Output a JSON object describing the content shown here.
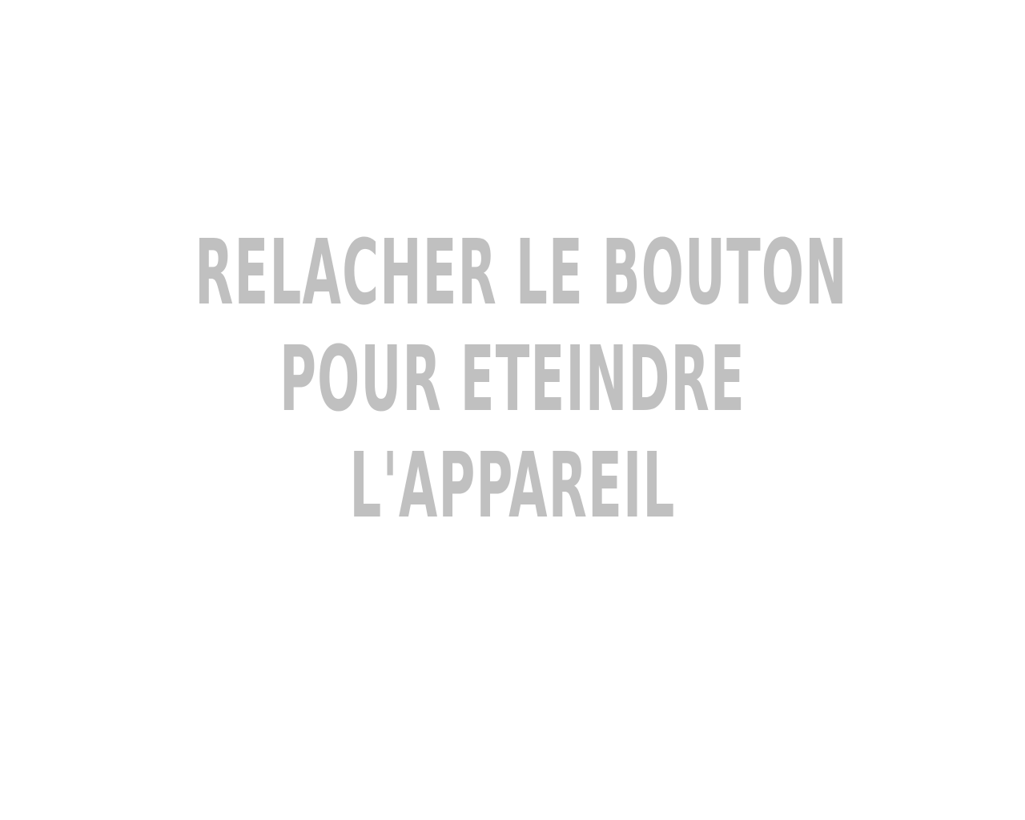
{
  "screen": {
    "background_color": "#ffffff",
    "text_color": "#c0c0c0",
    "message_lines": [
      "RELACHER LE BOUTON",
      "POUR ETEINDRE",
      "L'APPAREIL"
    ]
  }
}
